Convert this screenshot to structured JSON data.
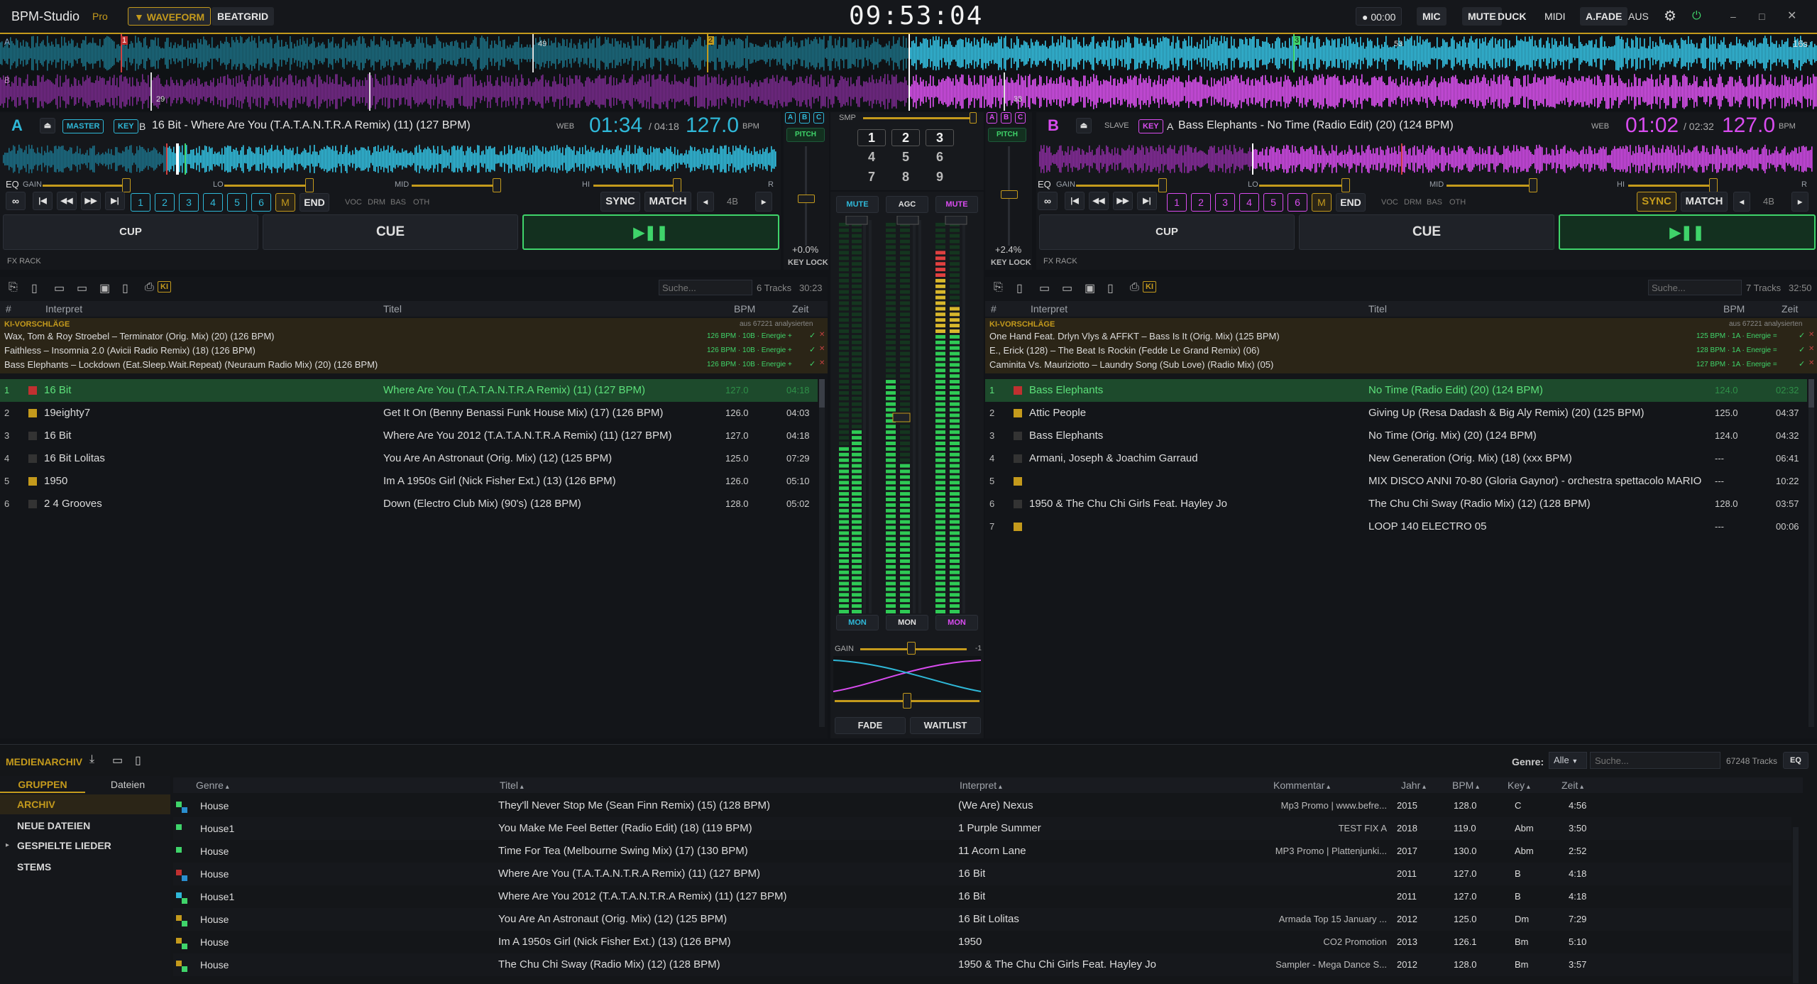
{
  "app": {
    "name": "BPM-Studio",
    "edition": "Pro"
  },
  "toolbar": {
    "waveform": "▼ WAVEFORM",
    "beatgrid": "BEATGRID",
    "clock": "09:53:04",
    "rec_time": "00:00",
    "mic": "MIC",
    "mute": "MUTE",
    "duck": "DUCK",
    "midi": "MIDI",
    "afade": "A.FADE",
    "afade_state": "AUS"
  },
  "overview": {
    "deck_a_letter": "A",
    "deck_b_letter": "B",
    "cue_labels": [
      "1",
      "49",
      "2",
      "29",
      "3",
      "53",
      "33"
    ],
    "right_time": "16s"
  },
  "deck_a": {
    "letter": "A",
    "role": "MASTER",
    "key_btn": "KEY",
    "key": "B",
    "title": "16 Bit - Where Are You (T.A.T.A.N.T.R.A Remix) (11) (127 BPM)",
    "web": "WEB",
    "elapsed": "01:34",
    "total": "/ 04:18",
    "bpm": "127.0",
    "bpm_label": "BPM",
    "eq": "EQ",
    "gain": "GAIN",
    "lo": "LO",
    "mid": "MID",
    "hi": "HI",
    "r": "R",
    "hotcues": [
      "1",
      "2",
      "3",
      "4",
      "5",
      "6"
    ],
    "m": "M",
    "end": "END",
    "voc": "VOC",
    "drm": "DRM",
    "bas": "BAS",
    "oth": "OTH",
    "sync": "SYNC",
    "match": "MATCH",
    "loop": "4B",
    "cup": "CUP",
    "cue": "CUE",
    "play": "▶❚❚",
    "fx": "FX RACK",
    "pitch_value": "+0.0%",
    "key_lock": "KEY LOCK",
    "pitch_label": "PITCH",
    "abc": [
      "A",
      "B",
      "C"
    ]
  },
  "deck_b": {
    "letter": "B",
    "role": "SLAVE",
    "key_btn": "KEY",
    "key": "A",
    "title": "Bass Elephants - No Time (Radio Edit) (20) (124 BPM)",
    "web": "WEB",
    "elapsed": "01:02",
    "total": "/ 02:32",
    "bpm": "127.0",
    "bpm_label": "BPM",
    "eq": "EQ",
    "gain": "GAIN",
    "lo": "LO",
    "mid": "MID",
    "hi": "HI",
    "r": "R",
    "hotcues": [
      "1",
      "2",
      "3",
      "4",
      "5",
      "6"
    ],
    "m": "M",
    "end": "END",
    "voc": "VOC",
    "drm": "DRM",
    "bas": "BAS",
    "oth": "OTH",
    "sync": "SYNC",
    "match": "MATCH",
    "loop": "4B",
    "cup": "CUP",
    "cue": "CUE",
    "play": "▶❚❚",
    "fx": "FX RACK",
    "pitch_value": "+2.4%",
    "key_lock": "KEY LOCK",
    "pitch_label": "PITCH",
    "abc": [
      "A",
      "B",
      "C"
    ]
  },
  "sampler": {
    "label": "SMP",
    "pads": [
      "1",
      "2",
      "3",
      "4",
      "5",
      "6",
      "7",
      "8",
      "9"
    ]
  },
  "mixer": {
    "mute_a": "MUTE",
    "agc": "AGC",
    "mute_b": "MUTE",
    "mon_a": "MON",
    "mon_m": "MON",
    "mon_b": "MON",
    "gain": "GAIN",
    "gain_val": "-1",
    "fade": "FADE",
    "waitlist": "WAITLIST"
  },
  "playlist_a": {
    "search_placeholder": "Suche...",
    "tracks": "6 Tracks",
    "duration": "30:23",
    "headers": {
      "num": "#",
      "artist": "Interpret",
      "title": "Titel",
      "bpm": "BPM",
      "time": "Zeit"
    },
    "ki_label": "KI-VORSCHLÄGE",
    "ki_info": "aus 67221 analysierten",
    "suggestions": [
      {
        "text": "Wax, Tom & Roy Stroebel – Terminator (Orig. Mix) (20) (126 BPM)",
        "meta": "126 BPM · 10B · Energie +"
      },
      {
        "text": "Faithless – Insomnia 2.0 (Avicii Radio Remix) (18) (126 BPM)",
        "meta": "126 BPM · 10B · Energie +"
      },
      {
        "text": "Bass Elephants – Lockdown (Eat.Sleep.Wait.Repeat) (Neuraum Radio Mix) (20) (126 BPM)",
        "meta": "126 BPM · 10B · Energie +"
      }
    ],
    "rows": [
      {
        "n": "1",
        "artist": "16 Bit",
        "title": "Where Are You (T.A.T.A.N.T.R.A Remix) (11) (127 BPM)",
        "bpm": "127.0",
        "time": "04:18"
      },
      {
        "n": "2",
        "artist": "19eighty7",
        "title": "Get It On (Benny Benassi Funk House Mix) (17) (126 BPM)",
        "bpm": "126.0",
        "time": "04:03"
      },
      {
        "n": "3",
        "artist": "16 Bit",
        "title": "Where Are You 2012 (T.A.T.A.N.T.R.A Remix) (11) (127 BPM)",
        "bpm": "127.0",
        "time": "04:18"
      },
      {
        "n": "4",
        "artist": "16 Bit Lolitas",
        "title": "You Are An Astronaut (Orig. Mix) (12) (125 BPM)",
        "bpm": "125.0",
        "time": "07:29"
      },
      {
        "n": "5",
        "artist": "1950",
        "title": "Im A 1950s Girl (Nick Fisher Ext.) (13) (126 BPM)",
        "bpm": "126.0",
        "time": "05:10"
      },
      {
        "n": "6",
        "artist": "2 4 Grooves",
        "title": "Down (Electro Club Mix) (90's) (128 BPM)",
        "bpm": "128.0",
        "time": "05:02"
      }
    ]
  },
  "playlist_b": {
    "search_placeholder": "Suche...",
    "tracks": "7 Tracks",
    "duration": "32:50",
    "headers": {
      "num": "#",
      "artist": "Interpret",
      "title": "Titel",
      "bpm": "BPM",
      "time": "Zeit"
    },
    "ki_label": "KI-VORSCHLÄGE",
    "ki_info": "aus 67221 analysierten",
    "suggestions": [
      {
        "text": "One Hand Feat. Drlyn Vlys & AFFKT – Bass Is It (Orig. Mix) (125 BPM)",
        "meta": "125 BPM · 1A · Energie ="
      },
      {
        "text": "E., Erick (128) – The Beat Is Rockin (Fedde Le Grand Remix) (06)",
        "meta": "128 BPM · 1A · Energie ="
      },
      {
        "text": "Caminita Vs. Mauriziotto – Laundry Song (Sub Love) (Radio Mix) (05)",
        "meta": "127 BPM · 1A · Energie ="
      }
    ],
    "rows": [
      {
        "n": "1",
        "artist": "Bass Elephants",
        "title": "No Time (Radio Edit) (20) (124 BPM)",
        "bpm": "124.0",
        "time": "02:32"
      },
      {
        "n": "2",
        "artist": "Attic People",
        "title": "Giving Up (Resa Dadash & Big Aly Remix) (20) (125 BPM)",
        "bpm": "125.0",
        "time": "04:37"
      },
      {
        "n": "3",
        "artist": "Bass Elephants",
        "title": "No Time (Orig. Mix) (20) (124 BPM)",
        "bpm": "124.0",
        "time": "04:32"
      },
      {
        "n": "4",
        "artist": "Armani, Joseph & Joachim Garraud",
        "title": "New Generation (Orig. Mix) (18) (xxx BPM)",
        "bpm": "---",
        "time": "06:41"
      },
      {
        "n": "5",
        "artist": "",
        "title": "MIX DISCO ANNI 70-80 (Gloria Gaynor) - orchestra spettacolo MARIO ...",
        "bpm": "---",
        "time": "10:22"
      },
      {
        "n": "6",
        "artist": "1950 & The Chu Chi Girls Feat. Hayley Jo",
        "title": "The Chu Chi Sway (Radio Mix) (12) (128 BPM)",
        "bpm": "128.0",
        "time": "03:57"
      },
      {
        "n": "7",
        "artist": "",
        "title": "LOOP 140 ELECTRO 05",
        "bpm": "---",
        "time": "00:06"
      }
    ]
  },
  "archive": {
    "title": "MEDIENARCHIV",
    "genre_label": "Genre:",
    "genre_value": "Alle",
    "search_placeholder": "Suche...",
    "count": "67248 Tracks",
    "eq": "EQ",
    "tabs": {
      "groups": "GRUPPEN",
      "files": "Dateien"
    },
    "groups": [
      "ARCHIV",
      "NEUE DATEIEN",
      "GESPIELTE LIEDER",
      "STEMS"
    ],
    "headers": {
      "genre": "Genre",
      "title": "Titel",
      "artist": "Interpret",
      "comment": "Kommentar",
      "year": "Jahr",
      "bpm": "BPM",
      "key": "Key",
      "time": "Zeit"
    },
    "rows": [
      {
        "genre": "House",
        "title": "They'll Never Stop Me (Sean Finn Remix) (15) (128 BPM)",
        "artist": "(We Are) Nexus",
        "comment": "Mp3 Promo | www.befre...",
        "year": "2015",
        "bpm": "128.0",
        "key": "C",
        "time": "4:56"
      },
      {
        "genre": "House1",
        "title": "You Make Me Feel Better (Radio Edit) (18) (119 BPM)",
        "artist": "1 Purple Summer",
        "comment": "TEST FIX A",
        "year": "2018",
        "bpm": "119.0",
        "key": "Abm",
        "time": "3:50"
      },
      {
        "genre": "House",
        "title": "Time For Tea (Melbourne Swing Mix) (17) (130 BPM)",
        "artist": "11 Acorn Lane",
        "comment": "MP3 Promo | Plattenjunki...",
        "year": "2017",
        "bpm": "130.0",
        "key": "Abm",
        "time": "2:52"
      },
      {
        "genre": "House",
        "title": "Where Are You (T.A.T.A.N.T.R.A Remix) (11) (127 BPM)",
        "artist": "16 Bit",
        "comment": "",
        "year": "2011",
        "bpm": "127.0",
        "key": "B",
        "time": "4:18"
      },
      {
        "genre": "House1",
        "title": "Where Are You 2012 (T.A.T.A.N.T.R.A Remix) (11) (127 BPM)",
        "artist": "16 Bit",
        "comment": "",
        "year": "2011",
        "bpm": "127.0",
        "key": "B",
        "time": "4:18"
      },
      {
        "genre": "House",
        "title": "You Are An Astronaut (Orig. Mix) (12) (125 BPM)",
        "artist": "16 Bit Lolitas",
        "comment": "Armada Top 15 January ...",
        "year": "2012",
        "bpm": "125.0",
        "key": "Dm",
        "time": "7:29"
      },
      {
        "genre": "House",
        "title": "Im A 1950s Girl (Nick Fisher Ext.) (13) (126 BPM)",
        "artist": "1950",
        "comment": "CO2 Promotion",
        "year": "2013",
        "bpm": "126.1",
        "key": "Bm",
        "time": "5:10"
      },
      {
        "genre": "House",
        "title": "The Chu Chi Sway (Radio Mix) (12) (128 BPM)",
        "artist": "1950 & The Chu Chi Girls Feat. Hayley Jo",
        "comment": "Sampler - Mega Dance S...",
        "year": "2012",
        "bpm": "128.0",
        "key": "Bm",
        "time": "3:57"
      }
    ]
  },
  "colors": {
    "accent": "#c49a1c",
    "deck_a": "#2fb8d8",
    "deck_b": "#d94cf0",
    "play": "#3fd46a"
  }
}
